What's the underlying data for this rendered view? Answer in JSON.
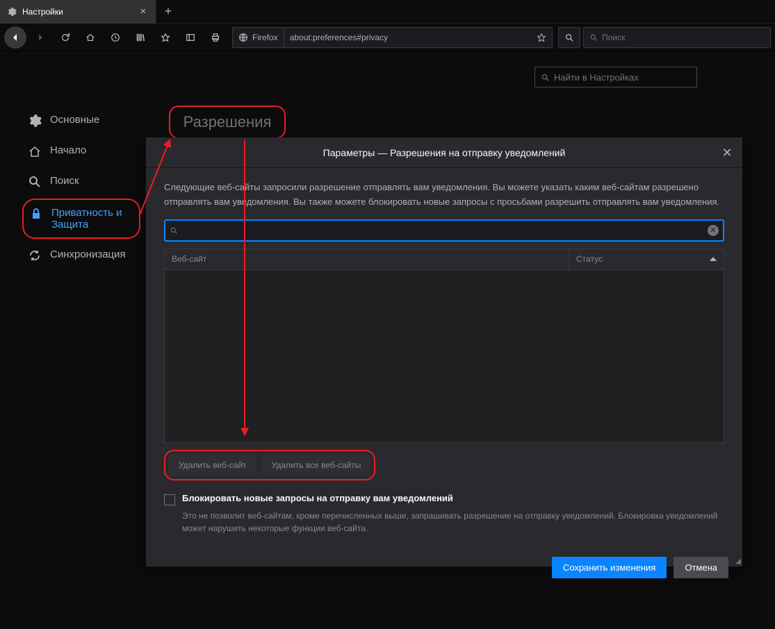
{
  "tab": {
    "title": "Настройки"
  },
  "urlbar": {
    "brand": "Firefox",
    "url": "about:preferences#privacy"
  },
  "searchbar": {
    "placeholder": "Поиск"
  },
  "settings_search": {
    "placeholder": "Найти в Настройках"
  },
  "sidebar": {
    "items": [
      {
        "label": "Основные"
      },
      {
        "label": "Начало"
      },
      {
        "label": "Поиск"
      },
      {
        "label": "Приватность и Защита"
      },
      {
        "label": "Синхронизация"
      }
    ]
  },
  "section_title": "Разрешения",
  "dialog": {
    "title": "Параметры — Разрешения на отправку уведомлений",
    "desc": "Следующие веб-сайты запросили разрешение отправлять вам уведомления. Вы можете указать каким веб-сайтам разрешено отправлять вам уведомления. Вы также можете блокировать новые запросы с просьбами разрешить отправлять вам уведомления.",
    "th_website": "Веб-сайт",
    "th_status": "Статус",
    "remove_one": "Удалить веб-сайт",
    "remove_all": "Удалить все веб-сайты",
    "block_label": "Блокировать новые запросы на отправку вам уведомлений",
    "block_desc": "Это не позволит веб-сайтам, кроме перечисленных выше, запрашивать разрешение на отправку уведомлений. Блокировка уведомлений может нарушить некоторые функции веб-сайта.",
    "save": "Сохранить изменения",
    "cancel": "Отмена"
  }
}
